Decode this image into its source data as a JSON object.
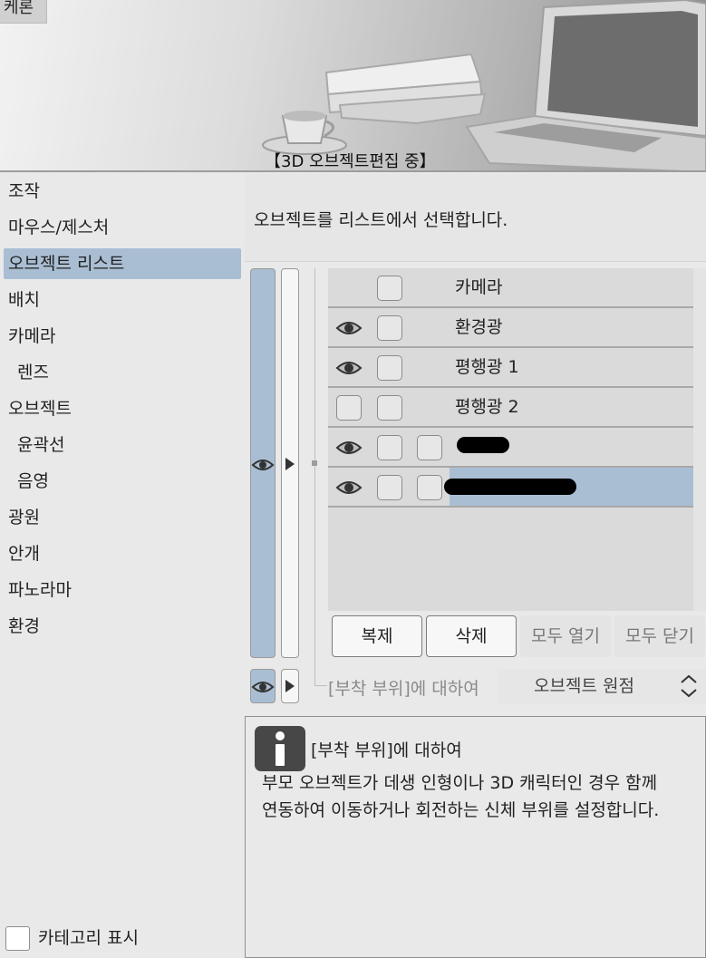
{
  "preview": {
    "tag": "케론",
    "caption": "【3D 오브젝트편집 중】"
  },
  "nav": {
    "items": [
      {
        "label": "조작"
      },
      {
        "label": "마우스/제스처"
      },
      {
        "label": "오브젝트 리스트"
      },
      {
        "label": "배치"
      },
      {
        "label": "카메라"
      },
      {
        "label": "렌즈"
      },
      {
        "label": "오브젝트"
      },
      {
        "label": "윤곽선"
      },
      {
        "label": "음영"
      },
      {
        "label": "광원"
      },
      {
        "label": "안개"
      },
      {
        "label": "파노라마"
      },
      {
        "label": "환경"
      }
    ],
    "active_item": "오브젝트 리스트",
    "category_toggle": {
      "label": "카테고리 표시",
      "checked": false
    }
  },
  "main": {
    "description": "오브젝트를 리스트에서 선택합니다.",
    "object_list": {
      "rows": [
        {
          "label": "카메라",
          "visible": false,
          "selected": false
        },
        {
          "label": "환경광",
          "visible": true,
          "selected": false
        },
        {
          "label": "평행광 1",
          "visible": true,
          "selected": false
        },
        {
          "label": "평행광 2",
          "visible": false,
          "selected": false
        },
        {
          "label": "",
          "visible": true,
          "selected": false,
          "redacted": true
        },
        {
          "label": "",
          "visible": true,
          "selected": true,
          "redacted": true
        }
      ]
    },
    "buttons": {
      "duplicate": "복제",
      "delete": "삭제",
      "open_all": "모두 열기",
      "close_all": "모두 닫기"
    },
    "attachment": {
      "label": "[부착 부위]에 대하여",
      "selected_value": "오브젝트 원점"
    },
    "help": {
      "title": "[부착 부위]에 대하여",
      "body_line1": "부모 오브젝트가 데생 인형이나 3D 캐릭터인 경우 함께",
      "body_line2": "연동하여 이동하거나 회전하는 신체 부위를 설정합니다."
    }
  },
  "colors": {
    "selection": "#a9bed3",
    "panel_bg": "#e9e9e9",
    "list_bg": "#dadada"
  }
}
